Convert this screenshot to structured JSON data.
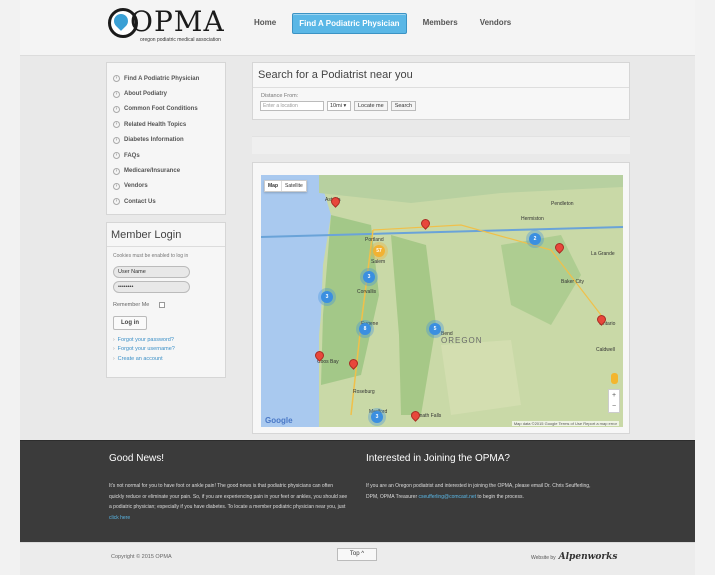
{
  "header": {
    "logo_text": "OPMA",
    "logo_subtitle": "oregon podiatric medical association",
    "nav": [
      "Home",
      "Find A Podiatric Physician",
      "Members",
      "Vendors"
    ],
    "active_nav": "Find A Podiatric Physician"
  },
  "sidebar": {
    "items": [
      "Find A Podiatric Physician",
      "About Podiatry",
      "Common Foot Conditions",
      "Related Health Topics",
      "Diabetes Information",
      "FAQs",
      "Medicare/Insurance",
      "Vendors",
      "Contact Us"
    ]
  },
  "login": {
    "title": "Member Login",
    "note": "Cookies must be enabled to log in",
    "username_value": "User Name",
    "password_value": "••••••••",
    "remember_label": "Remember Me",
    "button": "Log in",
    "links": [
      "Forgot your password?",
      "Forgot your username?",
      "Create an account"
    ]
  },
  "search": {
    "title": "Search for a Podiatrist near you",
    "distance_label": "Distance From:",
    "location_placeholder": "Enter a location",
    "distance_value": "10mi",
    "locate_button": "Locate me",
    "search_button": "Search"
  },
  "map": {
    "type_map": "Map",
    "type_satellite": "Satellite",
    "state_label": "OREGON",
    "cities": [
      "Portland",
      "Corvallis",
      "Coos Bay",
      "Roseburg",
      "Medford",
      "Klamath Falls",
      "Bend",
      "Pendleton",
      "La Grande",
      "Ontario",
      "Salem",
      "Eugene",
      "Astoria",
      "Baker City",
      "Caldwell",
      "Hermiston"
    ],
    "cluster_labels": [
      "57",
      "3",
      "3",
      "8",
      "5",
      "3",
      "2"
    ],
    "zoom_in": "+",
    "zoom_out": "−",
    "footer_text": "Map data ©2015 Google   Terms of Use   Report a map error",
    "brand": "Google",
    "colors": {
      "marker": "#e8473b",
      "cluster_blue": "#3b8fe0",
      "cluster_yellow": "#f2b233",
      "land": "#c9d9a7",
      "water": "#a9c9ef"
    }
  },
  "footer": {
    "left_title": "Good News!",
    "left_text": "It's not normal for you to have foot or ankle pain! The good news is that podiatric physicians can often quickly reduce or eliminate your pain. So, if you are experiencing pain in your feet or ankles, you should see a podiatric physician; especially if you have diabetes. To locate a member podiatric physician near you, just",
    "left_link": "click here",
    "right_title": "Interested in Joining the OPMA?",
    "right_text": "If you are an Oregon podiatrist and interested in joining the OPMA, please email Dr. Chris Seufferling, DPM, OPMA Treasurer",
    "right_email": "cseufferling@comcast.net",
    "right_text_end": "to begin the process."
  },
  "bottom": {
    "copyright": "Copyright © 2015 OPMA",
    "top_button": "Top ^",
    "credit_prefix": "Website by",
    "credit_brand": "Alpenworks"
  }
}
